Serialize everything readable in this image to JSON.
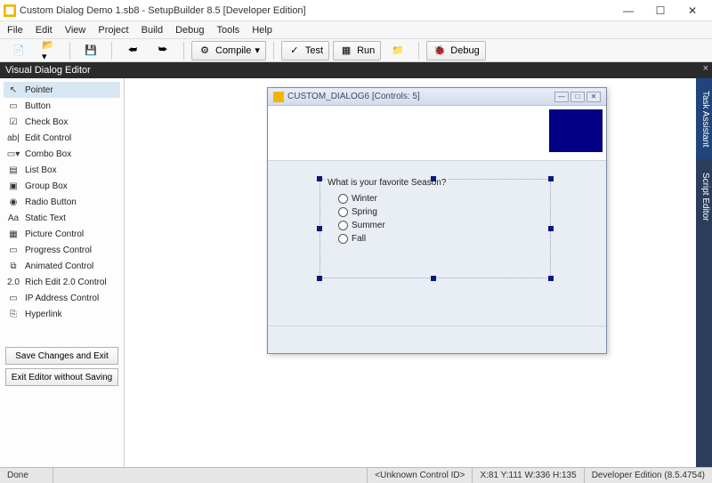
{
  "title": "Custom Dialog Demo 1.sb8 - SetupBuilder 8.5 [Developer Edition]",
  "menu": {
    "file": "File",
    "edit": "Edit",
    "view": "View",
    "project": "Project",
    "build": "Build",
    "debug": "Debug",
    "tools": "Tools",
    "help": "Help"
  },
  "toolbar": {
    "compile": "Compile",
    "test": "Test",
    "run": "Run",
    "debug": "Debug"
  },
  "strip_title": "Visual Dialog Editor",
  "tools": [
    {
      "label": "Pointer",
      "icon": "↖"
    },
    {
      "label": "Button",
      "icon": "▭"
    },
    {
      "label": "Check Box",
      "icon": "☑"
    },
    {
      "label": "Edit Control",
      "icon": "ab|"
    },
    {
      "label": "Combo Box",
      "icon": "▭▾"
    },
    {
      "label": "List Box",
      "icon": "▤"
    },
    {
      "label": "Group Box",
      "icon": "▣"
    },
    {
      "label": "Radio Button",
      "icon": "◉"
    },
    {
      "label": "Static Text",
      "icon": "Aa"
    },
    {
      "label": "Picture Control",
      "icon": "▦"
    },
    {
      "label": "Progress Control",
      "icon": "▭"
    },
    {
      "label": "Animated Control",
      "icon": "⧉"
    },
    {
      "label": "Rich Edit 2.0 Control",
      "icon": "2.0"
    },
    {
      "label": "IP Address Control",
      "icon": "▭"
    },
    {
      "label": "Hyperlink",
      "icon": "⎘"
    }
  ],
  "panel_buttons": {
    "save": "Save Changes and Exit",
    "exit": "Exit Editor without Saving"
  },
  "right_tabs": {
    "task": "Task Assistant",
    "script": "Script Editor"
  },
  "dialog": {
    "title": "CUSTOM_DIALOG6  [Controls: 5]",
    "groupbox_label": "What is your favorite Season?",
    "options": [
      "Winter",
      "Spring",
      "Summer",
      "Fall"
    ]
  },
  "status": {
    "done": "Done",
    "unknown": "<Unknown Control ID>",
    "coords": "X:81  Y:111  W:336  H:135",
    "edition": "Developer Edition (8.5.4754)"
  },
  "colors": {
    "darkblue": "#020183"
  }
}
